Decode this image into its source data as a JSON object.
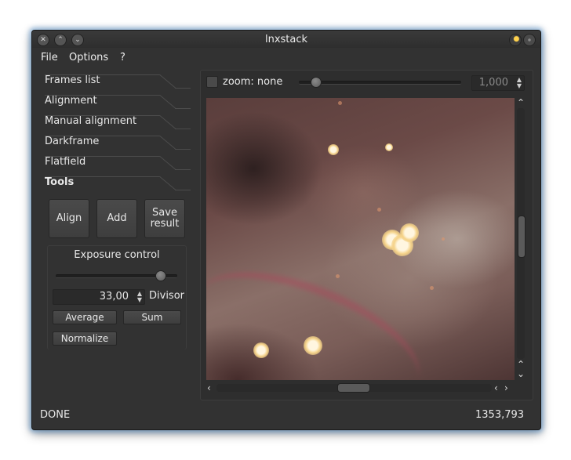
{
  "window": {
    "title": "lnxstack"
  },
  "menu": {
    "file": "File",
    "options": "Options",
    "help": "?"
  },
  "tabs": [
    {
      "label": "Frames list",
      "active": false
    },
    {
      "label": "Alignment",
      "active": false
    },
    {
      "label": "Manual alignment",
      "active": false
    },
    {
      "label": "Darkframe",
      "active": false
    },
    {
      "label": "Flatfield",
      "active": false
    },
    {
      "label": "Tools",
      "active": true
    }
  ],
  "tools": {
    "align": "Align",
    "add": "Add",
    "save_result": "Save\nresult"
  },
  "exposure": {
    "title": "Exposure control",
    "slider_level": 0.86,
    "divisor_value": "33,00",
    "divisor_label": "Divisor",
    "average": "Average",
    "sum": "Sum",
    "normalize": "Normalize"
  },
  "viewer": {
    "zoom_label": "zoom: none",
    "zoom_checked": false,
    "zoom_value": "1,000",
    "zoom_slider_level": 0.1
  },
  "status": {
    "left": "DONE",
    "right": "1353,793"
  },
  "colors": {
    "window_bg": "#323232",
    "glow": "#3c82c8",
    "text": "#e6e6e6"
  },
  "icons": [
    "close-icon",
    "minimize-icon",
    "maximize-icon",
    "keep-above-icon",
    "menu-dot-icon",
    "chevron-up-icon",
    "chevron-down-icon",
    "chevron-left-icon",
    "chevron-right-icon"
  ]
}
